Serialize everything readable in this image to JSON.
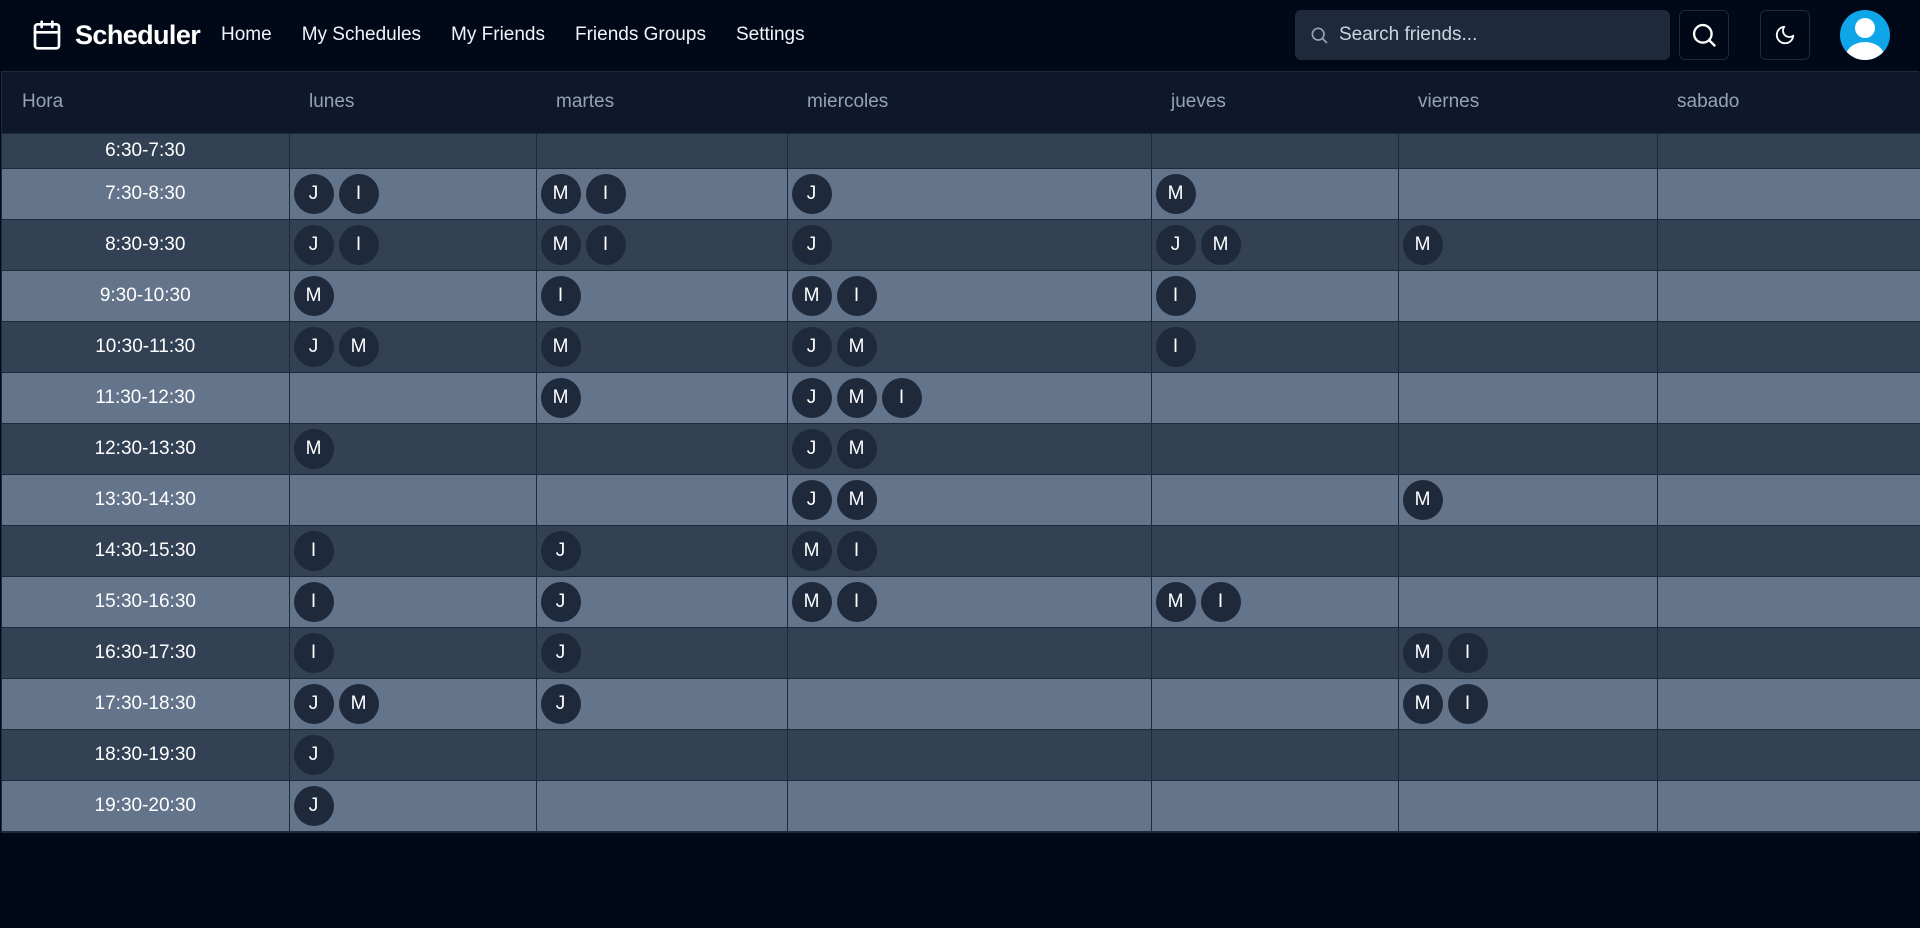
{
  "app": {
    "title": "Scheduler"
  },
  "nav": [
    "Home",
    "My Schedules",
    "My Friends",
    "Friends Groups",
    "Settings"
  ],
  "search": {
    "placeholder": "Search friends...",
    "value": ""
  },
  "icons": {
    "brand": "calendar-icon",
    "search_field": "search-icon",
    "search_button": "search-icon",
    "theme": "moon-icon",
    "avatar": "user-icon"
  },
  "colors": {
    "background": "#010817",
    "header_row": "#0f172a",
    "row_dark": "#334155",
    "row_light": "#64748b",
    "chip": "#1e293b",
    "avatar": "#0ea5e9"
  },
  "schedule": {
    "columns": [
      "Hora",
      "lunes",
      "martes",
      "miercoles",
      "jueves",
      "viernes",
      "sabado"
    ],
    "rows": [
      {
        "time": "6:30-7:30",
        "cells": [
          [],
          [],
          [],
          [],
          [],
          []
        ]
      },
      {
        "time": "7:30-8:30",
        "cells": [
          [
            "J",
            "I"
          ],
          [
            "M",
            "I"
          ],
          [
            "J"
          ],
          [
            "M"
          ],
          [],
          []
        ]
      },
      {
        "time": "8:30-9:30",
        "cells": [
          [
            "J",
            "I"
          ],
          [
            "M",
            "I"
          ],
          [
            "J"
          ],
          [
            "J",
            "M"
          ],
          [
            "M"
          ],
          []
        ]
      },
      {
        "time": "9:30-10:30",
        "cells": [
          [
            "M"
          ],
          [
            "I"
          ],
          [
            "M",
            "I"
          ],
          [
            "I"
          ],
          [],
          []
        ]
      },
      {
        "time": "10:30-11:30",
        "cells": [
          [
            "J",
            "M"
          ],
          [
            "M"
          ],
          [
            "J",
            "M"
          ],
          [
            "I"
          ],
          [],
          []
        ]
      },
      {
        "time": "11:30-12:30",
        "cells": [
          [],
          [
            "M"
          ],
          [
            "J",
            "M",
            "I"
          ],
          [],
          [],
          []
        ]
      },
      {
        "time": "12:30-13:30",
        "cells": [
          [
            "M"
          ],
          [],
          [
            "J",
            "M"
          ],
          [],
          [],
          []
        ]
      },
      {
        "time": "13:30-14:30",
        "cells": [
          [],
          [],
          [
            "J",
            "M"
          ],
          [],
          [
            "M"
          ],
          []
        ]
      },
      {
        "time": "14:30-15:30",
        "cells": [
          [
            "I"
          ],
          [
            "J"
          ],
          [
            "M",
            "I"
          ],
          [],
          [],
          []
        ]
      },
      {
        "time": "15:30-16:30",
        "cells": [
          [
            "I"
          ],
          [
            "J"
          ],
          [
            "M",
            "I"
          ],
          [
            "M",
            "I"
          ],
          [],
          []
        ]
      },
      {
        "time": "16:30-17:30",
        "cells": [
          [
            "I"
          ],
          [
            "J"
          ],
          [],
          [],
          [
            "M",
            "I"
          ],
          []
        ]
      },
      {
        "time": "17:30-18:30",
        "cells": [
          [
            "J",
            "M"
          ],
          [
            "J"
          ],
          [],
          [],
          [
            "M",
            "I"
          ],
          []
        ]
      },
      {
        "time": "18:30-19:30",
        "cells": [
          [
            "J"
          ],
          [],
          [],
          [],
          [],
          []
        ]
      },
      {
        "time": "19:30-20:30",
        "cells": [
          [
            "J"
          ],
          [],
          [],
          [],
          [],
          []
        ]
      }
    ]
  }
}
